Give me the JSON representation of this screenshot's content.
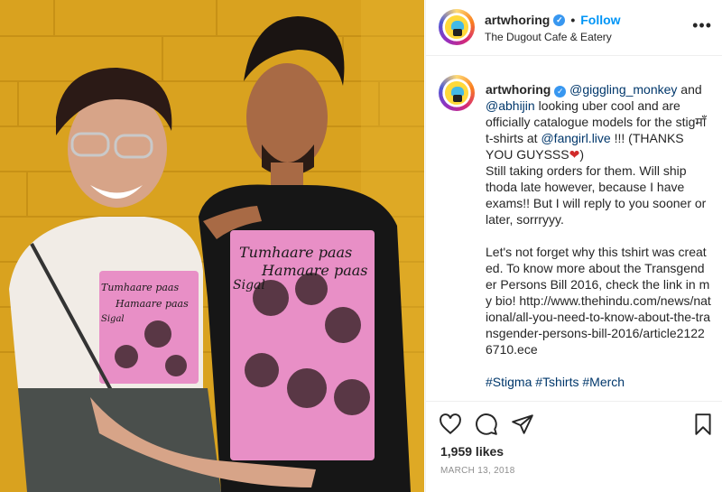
{
  "post": {
    "image_alt": "Two people posing in printed t-shirts in front of a yellow brick wall",
    "shirt_print_text": [
      "Tumhaare paas",
      "Hamaare paas",
      "Sigal"
    ]
  },
  "header": {
    "username": "artwhoring",
    "verified_glyph": "✓",
    "separator": "•",
    "follow_label": "Follow",
    "location": "The Dugout Cafe & Eatery",
    "more_glyph": "•••"
  },
  "caption": {
    "username": "artwhoring",
    "mention1": "@giggling_monkey",
    "text1": " and ",
    "mention2": "@abhijin",
    "text2": " looking uber cool and are officially catalogue models for the stigमाँ t-shirts at ",
    "mention3": "@fangirl.live",
    "text3": " !!! (THANKS YOU GUYSSS",
    "heart": "❤",
    "text4": ")",
    "text5": "Still taking orders for them. Will ship thoda late however, because I have exams!! But I will reply to you sooner or later, sorrryyy.",
    "text6": "Let's not forget why this tshirt was created. To know more about the Transgender Persons Bill 2016, check the link in my bio! http://www.thehindu.com/news/national/all-you-need-to-know-about-the-transgender-persons-bill-2016/article21226710.ece",
    "hashtags": "#Stigma #Tshirts #Merch"
  },
  "actions": {
    "like_icon": "heart-outline-icon",
    "comment_icon": "comment-icon",
    "share_icon": "paper-plane-icon",
    "save_icon": "bookmark-icon",
    "likes": "1,959 likes",
    "date": "MARCH 13, 2018"
  },
  "colors": {
    "accent": "#0095f6",
    "wall": "#d9a21f",
    "shirt_print": "#e88fc6",
    "link": "#00376b",
    "muted": "#8e8e8e"
  }
}
